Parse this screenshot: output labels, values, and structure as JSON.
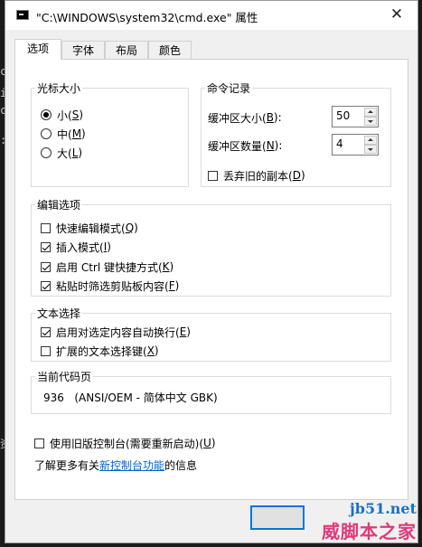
{
  "window": {
    "title": "\"C:\\WINDOWS\\system32\\cmd.exe\" 属性",
    "close_glyph": "✕"
  },
  "tabs": [
    {
      "label": "选项",
      "active": true
    },
    {
      "label": "字体",
      "active": false
    },
    {
      "label": "布局",
      "active": false
    },
    {
      "label": "颜色",
      "active": false
    }
  ],
  "cursor_size": {
    "legend": "光标大小",
    "options": [
      {
        "label": "小(",
        "key": "S",
        "end": ")",
        "selected": true
      },
      {
        "label": "中(",
        "key": "M",
        "end": ")",
        "selected": false
      },
      {
        "label": "大(",
        "key": "L",
        "end": ")",
        "selected": false
      }
    ]
  },
  "command_history": {
    "legend": "命令记录",
    "buffer_size": {
      "label": "缓冲区大小(",
      "key": "B",
      "end": "):",
      "value": "50"
    },
    "buffer_count": {
      "label": "缓冲区数量(",
      "key": "N",
      "end": "):",
      "value": "4"
    },
    "discard_old": {
      "label": "丢弃旧的副本(",
      "key": "D",
      "end": ")",
      "checked": false
    }
  },
  "edit_options": {
    "legend": "编辑选项",
    "items": [
      {
        "label": "快速编辑模式(",
        "key": "Q",
        "end": ")",
        "checked": false
      },
      {
        "label": "插入模式(",
        "key": "I",
        "end": ")",
        "checked": true
      },
      {
        "label": "启用 Ctrl 键快捷方式(",
        "key": "K",
        "end": ")",
        "checked": true
      },
      {
        "label": "粘贴时筛选剪贴板内容(",
        "key": "F",
        "end": ")",
        "checked": true
      }
    ]
  },
  "text_selection": {
    "legend": "文本选择",
    "items": [
      {
        "label": "启用对选定内容自动换行(",
        "key": "E",
        "end": ")",
        "checked": true
      },
      {
        "label": "扩展的文本选择键(",
        "key": "X",
        "end": ")",
        "checked": false
      }
    ]
  },
  "codepage": {
    "legend": "当前代码页",
    "value": "936   (ANSI/OEM - 简体中文 GBK)"
  },
  "legacy": {
    "label": "使用旧版控制台(需要重新启动)(",
    "key": "U",
    "end": ")",
    "checked": false
  },
  "learn_more": {
    "before": "了解更多有关",
    "link": "新控制台功能",
    "after": "的信息"
  },
  "backdrop_chars": [
    "c",
    "i",
    "c",
    ":",
    "资"
  ],
  "watermark": {
    "line1": "jb51.net",
    "line2": "威脚本之家"
  }
}
